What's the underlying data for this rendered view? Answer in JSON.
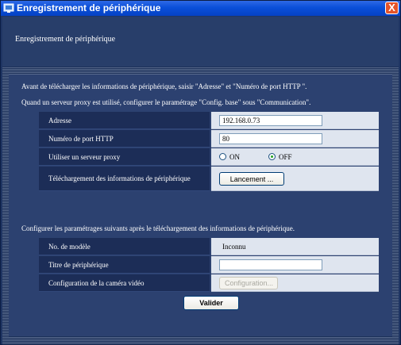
{
  "window": {
    "title": "Enregistrement de périphérique",
    "close_glyph": "X"
  },
  "header": {
    "subtitle": "Enregistrement de périphérique"
  },
  "intro": {
    "line1": "Avant de télécharger les informations de périphérique, saisir \"Adresse\" et \"Numéro de port HTTP \".",
    "line2": "Quand un serveur proxy est utilisé, configurer le paramétrage \"Config. base\" sous \"Communication\"."
  },
  "form1": {
    "address_label": "Adresse",
    "address_value": "192.168.0.73",
    "port_label": "Numéro de port HTTP",
    "port_value": "80",
    "proxy_label": "Utiliser un serveur proxy",
    "proxy_on_label": "ON",
    "proxy_off_label": "OFF",
    "proxy_selected": "OFF",
    "download_label": "Téléchargement des informations de périphérique",
    "download_button": "Lancement ..."
  },
  "after_text": "Configurer les paramétrages suivants après le téléchargement des informations de périphérique.",
  "form2": {
    "model_label": "No. de modèle",
    "model_value": "Inconnu",
    "title_label": "Titre de périphérique",
    "title_value": "",
    "camera_label": "Configuration de la caméra vidéo",
    "camera_button": "Configuration..."
  },
  "submit_button": "Valider",
  "colors": {
    "titlebar": "#0a4fd9",
    "panel": "#2c4170",
    "label_cell": "#1c2d57",
    "value_cell": "#dfe5ef",
    "close": "#e4542a"
  }
}
